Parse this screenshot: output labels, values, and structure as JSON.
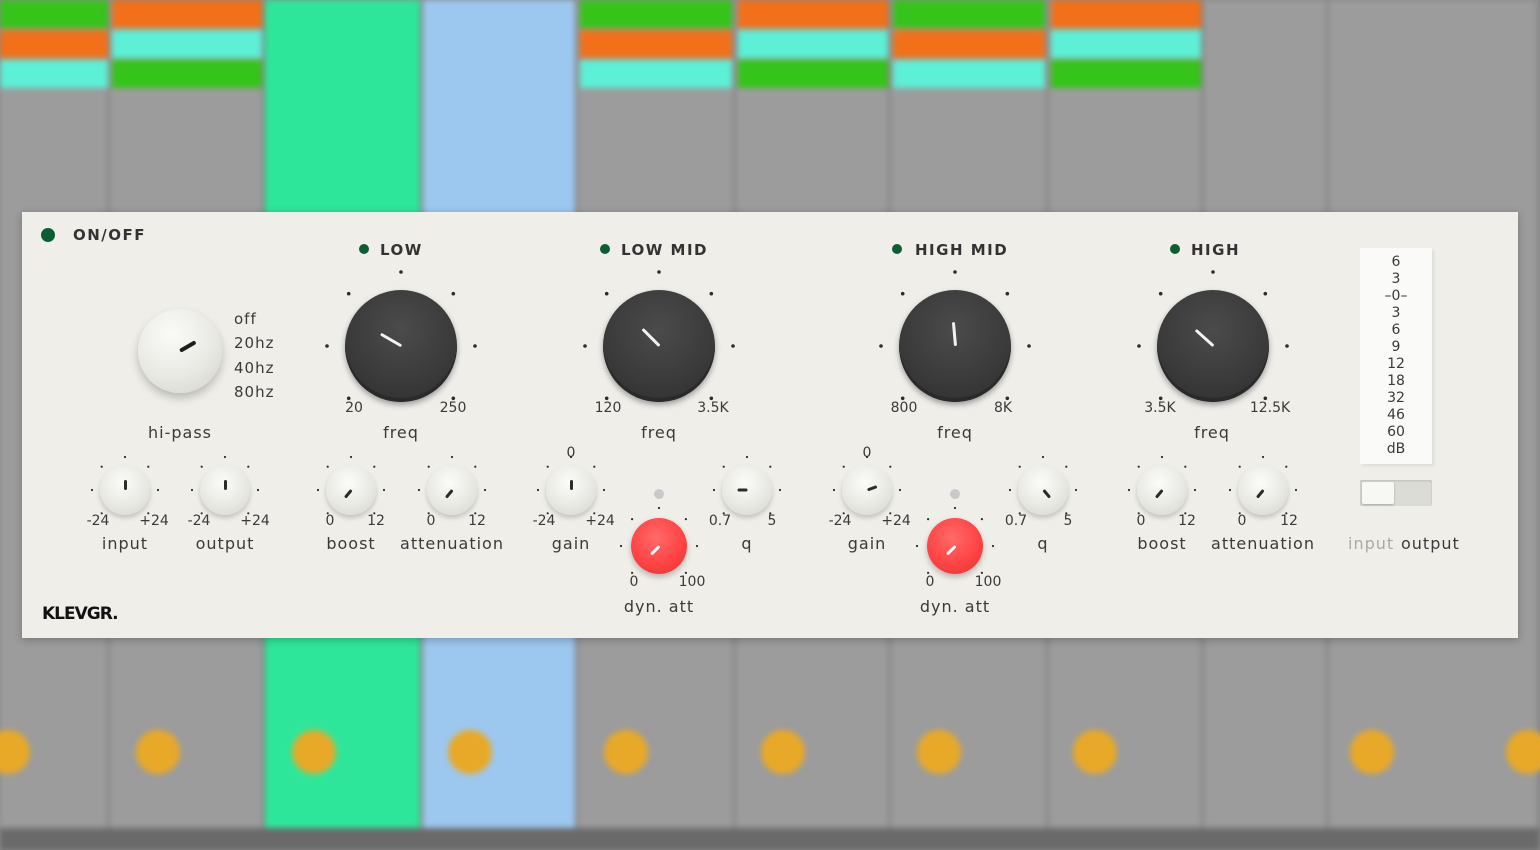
{
  "plugin": {
    "brand": "KLEVGR.",
    "power_label": "ON/OFF",
    "hipass": {
      "label": "hi-pass",
      "options": [
        "off",
        "20hz",
        "40hz",
        "80hz"
      ]
    },
    "input": {
      "label": "input",
      "min": "-24",
      "max": "+24"
    },
    "output": {
      "label": "output",
      "min": "-24",
      "max": "+24"
    },
    "bands": {
      "low": {
        "title": "LOW",
        "freq_label": "freq",
        "freq_min": "20",
        "freq_max": "250",
        "boost": {
          "label": "boost",
          "min": "0",
          "max": "12"
        },
        "atten": {
          "label": "attenuation",
          "min": "0",
          "max": "12"
        }
      },
      "lowmid": {
        "title": "LOW MID",
        "freq_label": "freq",
        "freq_min": "120",
        "freq_max": "3.5K",
        "gain": {
          "label": "gain",
          "top": "0",
          "min": "-24",
          "max": "+24"
        },
        "q": {
          "label": "q",
          "min": "0.7",
          "max": "5"
        },
        "dyn": {
          "label": "dyn. att",
          "min": "0",
          "max": "100"
        }
      },
      "highmid": {
        "title": "HIGH MID",
        "freq_label": "freq",
        "freq_min": "800",
        "freq_max": "8K",
        "gain": {
          "label": "gain",
          "top": "0",
          "min": "-24",
          "max": "+24"
        },
        "q": {
          "label": "q",
          "min": "0.7",
          "max": "5"
        },
        "dyn": {
          "label": "dyn. att",
          "min": "0",
          "max": "100"
        }
      },
      "high": {
        "title": "HIGH",
        "freq_label": "freq",
        "freq_min": "3.5K",
        "freq_max": "12.5K",
        "boost": {
          "label": "boost",
          "min": "0",
          "max": "12"
        },
        "atten": {
          "label": "attenuation",
          "min": "0",
          "max": "12"
        }
      }
    },
    "meter": {
      "scale": [
        "6",
        "3",
        "–0–",
        "3",
        "6",
        "9",
        "12",
        "18",
        "32",
        "46",
        "60",
        "dB"
      ],
      "switch_left": "input",
      "switch_right": "output"
    },
    "colors": {
      "panel": "#efeee9",
      "led": "#0c5e32",
      "dyn_knob": "#ff4444",
      "freq_knob": "#3a3a3a"
    }
  }
}
